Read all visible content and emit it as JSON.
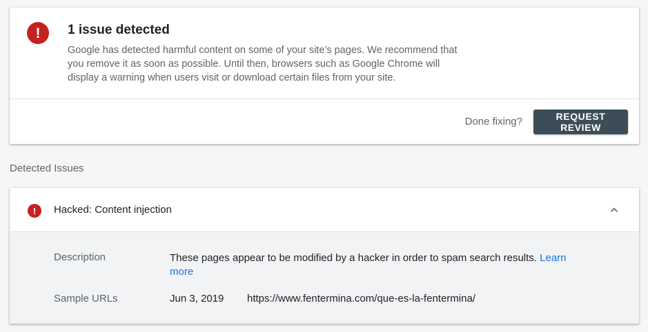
{
  "summary": {
    "title": "1 issue detected",
    "description": "Google has detected harmful content on some of your site’s pages. We recommend that you remove it as soon as possible. Until then, browsers such as Google Chrome will display a warning when users visit or download certain files from your site.",
    "done_text": "Done fixing?",
    "review_button": "REQUEST REVIEW",
    "alert_glyph": "!"
  },
  "section": {
    "heading": "Detected Issues"
  },
  "issue": {
    "title": "Hacked: Content injection",
    "alert_glyph": "!",
    "expanded": true,
    "description_label": "Description",
    "description_text": "These pages appear to be modified by a hacker in order to spam search results.",
    "learn_more": "Learn more",
    "sample_urls_label": "Sample URLs",
    "sample_urls": [
      {
        "date": "Jun 3, 2019",
        "url": "https://www.fentermina.com/que-es-la-fentermina/"
      }
    ]
  },
  "colors": {
    "alert": "#c5221f",
    "button": "#3c4d57",
    "link": "#1a73e8",
    "secondary_text": "#5f6368",
    "body_bg": "#f1f3f4"
  },
  "icons": {
    "summary_alert": "error-icon",
    "issue_alert": "error-icon",
    "collapse": "chevron-up-icon"
  }
}
